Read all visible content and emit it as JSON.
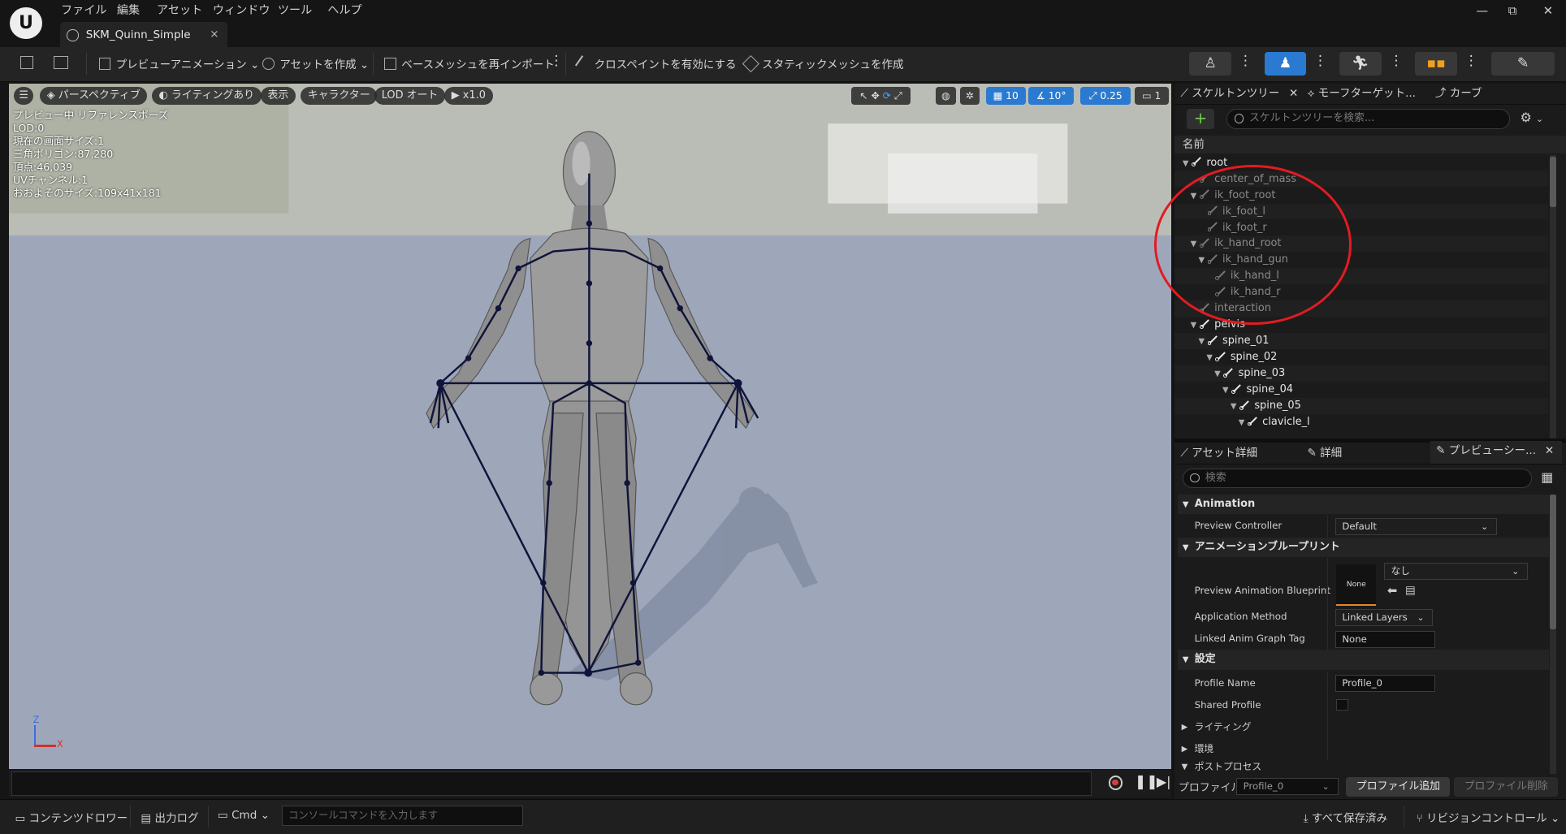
{
  "menu": [
    "ファイル",
    "編集",
    "アセット",
    "ウィンドウ",
    "ツール",
    "ヘルプ"
  ],
  "tab": {
    "title": "SKM_Quinn_Simple",
    "close": "×"
  },
  "window": {
    "minimize": "—",
    "maximize": "⧉",
    "close": "✕"
  },
  "toolbar": {
    "preview_animation": "プレビューアニメーション",
    "create_asset": "アセットを作成",
    "reimport_base_mesh": "ベースメッシュを再インポート",
    "enable_cloth_paint": "クロスペイントを有効にする",
    "create_static_mesh": "スタティックメッシュを作成"
  },
  "viewport": {
    "perspective": "パースペクティブ",
    "lighting": "ライティングあり",
    "show": "表示",
    "character": "キャラクター",
    "lod": "LOD オート",
    "speed": "x1.0",
    "grid_size": "10",
    "rotate_snap": "10°",
    "scale_snap": "0.25",
    "camera_speed": "1",
    "stats": [
      "プレビュー中 リファレンスポーズ",
      "LOD:0",
      "現在の画面サイズ:1",
      "三角ポリゴン:87,280",
      "頂点:46,039",
      "UVチャンネル:1",
      "おおよそのサイズ:109x41x181"
    ],
    "axis_z": "Z",
    "axis_x": "X"
  },
  "statusbar": {
    "content_drawer": "コンテンツドロワー",
    "output_log": "出力ログ",
    "cmd": "Cmd",
    "console_placeholder": "コンソールコマンドを入力します",
    "save_all": "すべて保存済み",
    "revision_control": "リビジョンコントロール"
  },
  "skeleton_panel": {
    "tabs": [
      "スケルトンツリー",
      "モーフターゲット...",
      "カーブ"
    ],
    "search_placeholder": "スケルトンツリーを検索...",
    "column_name": "名前",
    "bones": [
      {
        "name": "root",
        "depth": 0,
        "expanded": true,
        "dim": false
      },
      {
        "name": "center_of_mass",
        "depth": 1,
        "expanded": null,
        "dim": true
      },
      {
        "name": "ik_foot_root",
        "depth": 1,
        "expanded": true,
        "dim": true
      },
      {
        "name": "ik_foot_l",
        "depth": 2,
        "expanded": null,
        "dim": true
      },
      {
        "name": "ik_foot_r",
        "depth": 2,
        "expanded": null,
        "dim": true
      },
      {
        "name": "ik_hand_root",
        "depth": 1,
        "expanded": true,
        "dim": true
      },
      {
        "name": "ik_hand_gun",
        "depth": 2,
        "expanded": true,
        "dim": true
      },
      {
        "name": "ik_hand_l",
        "depth": 3,
        "expanded": null,
        "dim": true
      },
      {
        "name": "ik_hand_r",
        "depth": 3,
        "expanded": null,
        "dim": true
      },
      {
        "name": "interaction",
        "depth": 1,
        "expanded": null,
        "dim": true
      },
      {
        "name": "pelvis",
        "depth": 1,
        "expanded": true,
        "dim": false
      },
      {
        "name": "spine_01",
        "depth": 2,
        "expanded": true,
        "dim": false
      },
      {
        "name": "spine_02",
        "depth": 3,
        "expanded": true,
        "dim": false
      },
      {
        "name": "spine_03",
        "depth": 4,
        "expanded": true,
        "dim": false
      },
      {
        "name": "spine_04",
        "depth": 5,
        "expanded": true,
        "dim": false
      },
      {
        "name": "spine_05",
        "depth": 6,
        "expanded": true,
        "dim": false
      },
      {
        "name": "clavicle_l",
        "depth": 7,
        "expanded": true,
        "dim": false
      }
    ]
  },
  "details_panel": {
    "tabs": [
      "アセット詳細",
      "詳細",
      "プレビューシー..."
    ],
    "search_placeholder": "検索",
    "sections": {
      "animation": "Animation",
      "anim_blueprint": "アニメーションブループリント",
      "settings": "設定",
      "lighting": "ライティング",
      "environment": "環境",
      "post_process": "ポストプロセス"
    },
    "props": {
      "preview_controller_label": "Preview Controller",
      "preview_controller_value": "Default",
      "preview_anim_bp_label": "Preview Animation Blueprint",
      "preview_anim_bp_thumb": "None",
      "preview_anim_bp_value": "なし",
      "application_method_label": "Application Method",
      "application_method_value": "Linked Layers",
      "linked_anim_graph_tag_label": "Linked Anim Graph Tag",
      "linked_anim_graph_tag_value": "None",
      "profile_name_label": "Profile Name",
      "profile_name_value": "Profile_0",
      "shared_profile_label": "Shared Profile"
    },
    "footer": {
      "profile_label": "プロファイル",
      "profile_value": "Profile_0",
      "add_profile": "プロファイル追加",
      "remove_profile": "プロファイル削除"
    }
  },
  "colors": {
    "accent_blue": "#2a7ad1",
    "annotation_red": "#e21b22",
    "orange_underline": "#e6842a"
  }
}
